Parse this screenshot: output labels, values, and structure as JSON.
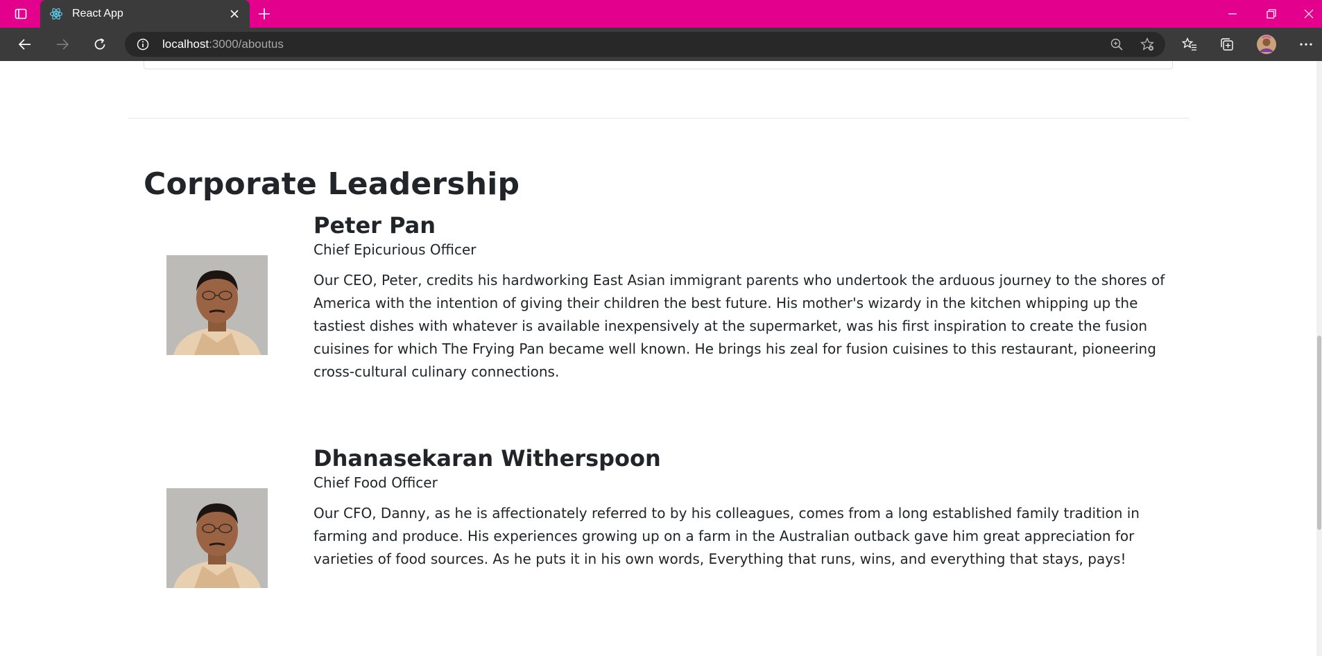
{
  "browser": {
    "tab_title": "React App",
    "url_host": "localhost",
    "url_rest": ":3000/aboutus"
  },
  "page": {
    "section_heading": "Corporate Leadership",
    "leaders": [
      {
        "name": "Peter Pan",
        "designation": "Chief Epicurious Officer",
        "description": "Our CEO, Peter, credits his hardworking East Asian immigrant parents who undertook the arduous journey to the shores of America with the intention of giving their children the best future. His mother's wizardy in the kitchen whipping up the tastiest dishes with whatever is available inexpensively at the supermarket, was his first inspiration to create the fusion cuisines for which The Frying Pan became well known. He brings his zeal for fusion cuisines to this restaurant, pioneering cross-cultural culinary connections."
      },
      {
        "name": "Dhanasekaran Witherspoon",
        "designation": "Chief Food Officer",
        "description": "Our CFO, Danny, as he is affectionately referred to by his colleagues, comes from a long established family tradition in farming and produce. His experiences growing up on a farm in the Australian outback gave him great appreciation for varieties of food sources. As he puts it in his own words, Everything that runs, wins, and everything that stays, pays!"
      }
    ]
  }
}
